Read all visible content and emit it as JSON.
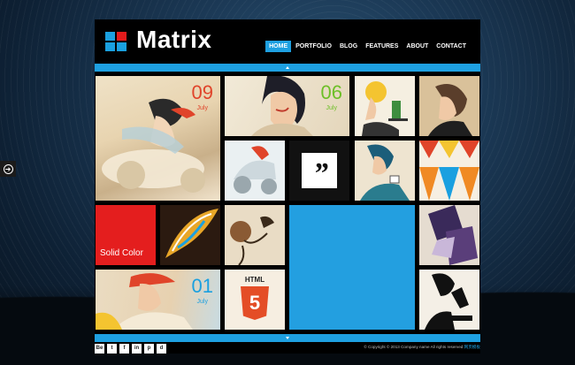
{
  "site": {
    "logo_text": "Matrix",
    "nav": [
      "HOME",
      "PORTFOLIO",
      "BLOG",
      "FEATURES",
      "ABOUT",
      "CONTACT"
    ],
    "active_nav": "HOME"
  },
  "tiles": {
    "post_1": {
      "day": "09",
      "month": "July",
      "color": "#e0442a"
    },
    "post_2": {
      "day": "06",
      "month": "July",
      "color": "#6dbf27"
    },
    "post_3": {
      "day": "01",
      "month": "July",
      "color": "#1aa0e0"
    },
    "solid_color_label": "Solid Color",
    "quote_mark": "”",
    "html5_word": "HTML",
    "html5_number": "5"
  },
  "footer": {
    "social": [
      "Be",
      "t",
      "f",
      "in",
      "p",
      "d"
    ],
    "copyright": "© Copyright © 2013 Company name All rights reserved",
    "copyright_link": "网页模板"
  },
  "colors": {
    "accent": "#1ea0e1",
    "red": "#e41e1e",
    "background": "#000000"
  }
}
